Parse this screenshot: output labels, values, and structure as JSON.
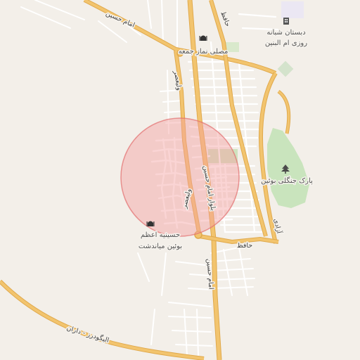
{
  "map": {
    "colors": {
      "background": "#f3efe9",
      "block": "#ebe7e1",
      "major_road": "#f2c46e",
      "major_road_casing": "#e0a94c",
      "minor_road": "#ffffff",
      "park": "#c9e4bd",
      "highlight_fill": "#f4a0a0",
      "highlight_stroke": "#e36d6d"
    },
    "labels": {
      "road_imam_hossein_top": "امام حسین",
      "road_imam_hossein_south": "امام حسین",
      "road_hafez_top": "حافظ",
      "road_hafez_bottom": "حافظ",
      "road_valiasr_north": "ولیعصر",
      "road_valiasr_center": "ولیعصر",
      "road_boulevard": "بلوار امام حسین",
      "road_azadi": "آزادی",
      "road_highway": "الیگودرز - داران"
    },
    "pois": {
      "mosalla": {
        "name": "مصلی نماز جمعه",
        "icon": "mosque-icon"
      },
      "school": {
        "name_line1": "دبستان شبانه",
        "name_line2": "روزی ام البنین",
        "icon": "school-icon"
      },
      "park": {
        "name": "پارک جنگلی بوئین",
        "icon": "tree-icon"
      },
      "hosseinieh": {
        "name_line1": "حسینیه اعظم",
        "name_line2": "بوئین میاندشت",
        "icon": "mosque-icon"
      }
    }
  }
}
